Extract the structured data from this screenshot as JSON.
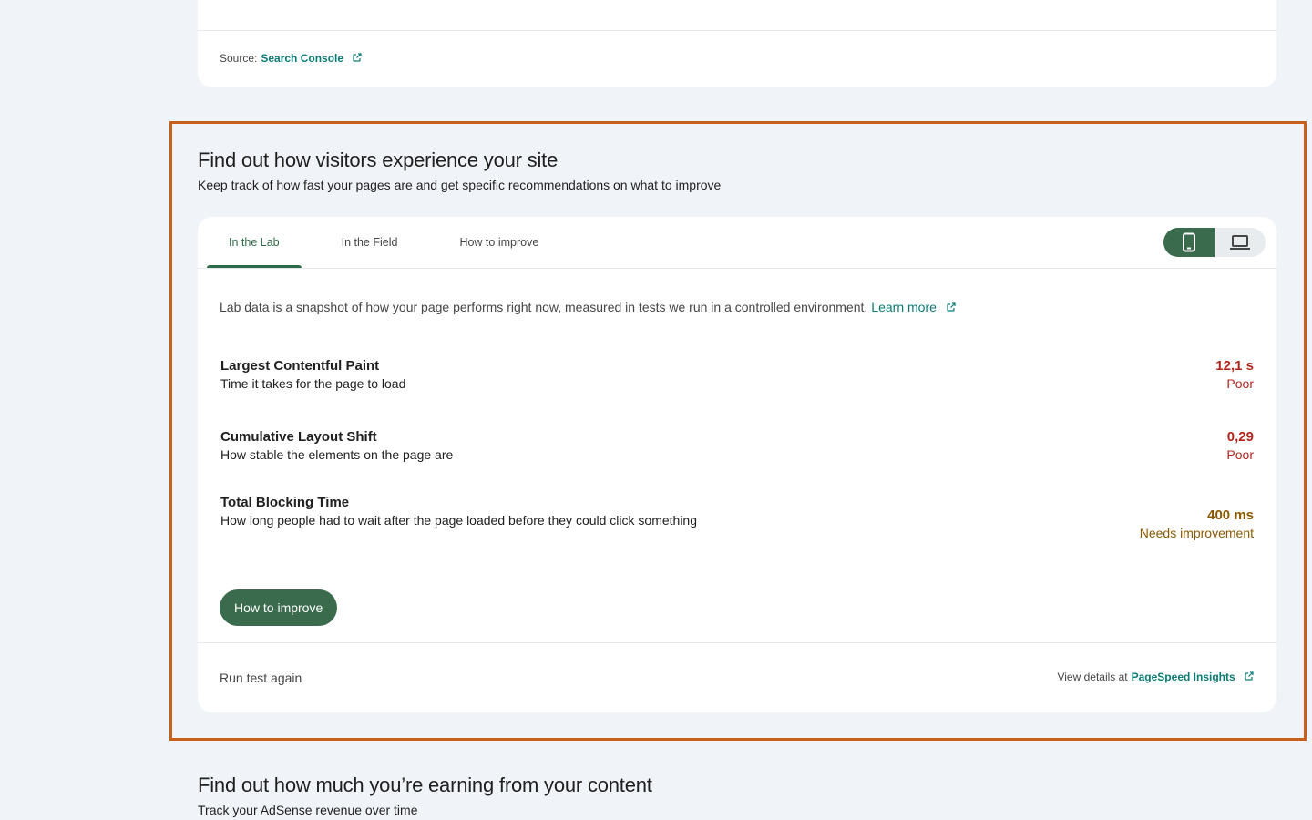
{
  "top_card": {
    "source_label": "Source:",
    "source_link": "Search Console"
  },
  "experience": {
    "title": "Find out how visitors experience your site",
    "subtitle": "Keep track of how fast your pages are and get specific recommendations on what to improve",
    "tabs": [
      {
        "label": "In the Lab",
        "active": true
      },
      {
        "label": "In the Field",
        "active": false
      },
      {
        "label": "How to improve",
        "active": false
      }
    ],
    "device_toggle": {
      "selected": "mobile",
      "options": [
        "mobile-icon",
        "laptop-icon"
      ]
    },
    "lab_description": "Lab data is a snapshot of how your page performs right now, measured in tests we run in a controlled environment.",
    "learn_more": "Learn more",
    "metrics": [
      {
        "name": "Largest Contentful Paint",
        "description": "Time it takes for the page to load",
        "value": "12,1 s",
        "rating": "Poor",
        "status": "poor"
      },
      {
        "name": "Cumulative Layout Shift",
        "description": "How stable the elements on the page are",
        "value": "0,29",
        "rating": "Poor",
        "status": "poor"
      },
      {
        "name": "Total Blocking Time",
        "description": "How long people had to wait after the page loaded before they could click something",
        "value": "400 ms",
        "rating": "Needs improvement",
        "status": "needs-improvement"
      }
    ],
    "improve_button": "How to improve",
    "run_again": "Run test again",
    "view_details_label": "View details at",
    "view_details_link": "PageSpeed Insights"
  },
  "earnings": {
    "title": "Find out how much you’re earning from your content",
    "subtitle": "Track your AdSense revenue over time"
  },
  "colors": {
    "accent_green": "#3a6b4c",
    "link_teal": "#0b7a75",
    "poor_red": "#b3261e",
    "needs_amber": "#8a5a00",
    "highlight_orange": "#c8601c",
    "background": "#f0f4f9"
  }
}
